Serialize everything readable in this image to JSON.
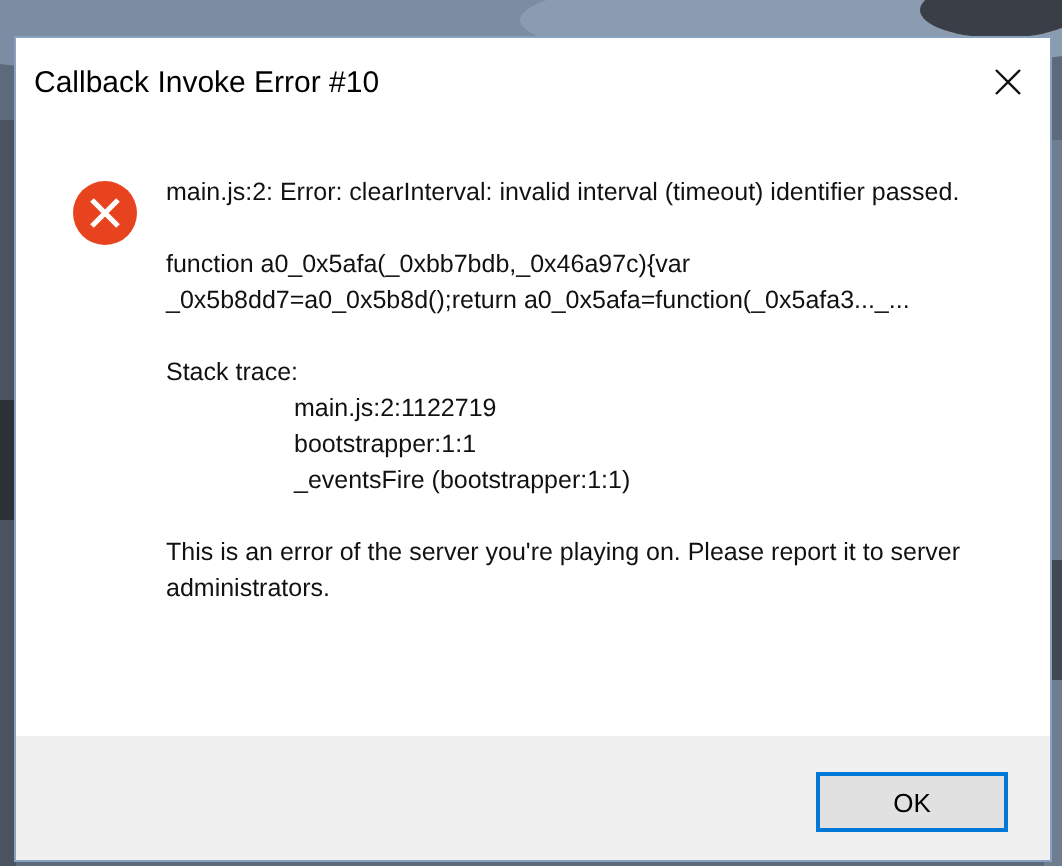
{
  "window": {
    "title": "Callback Invoke Error #10"
  },
  "message": {
    "kind": "error",
    "text": "main.js:2: Error: clearInterval: invalid interval (timeout) identifier passed.",
    "code_lines": [
      "function a0_0x5afa(_0xbb7bdb,_0x46a97c){var",
      "_0x5b8dd7=a0_0x5b8d();return a0_0x5afa=function(_0x5afa3..._..."
    ],
    "stack_label": "Stack trace:",
    "stack_frames": [
      "main.js:2:1122719",
      "bootstrapper:1:1",
      "_eventsFire (bootstrapper:1:1)"
    ],
    "note": "This is an error of the server you're playing on. Please report it to server administrators."
  },
  "buttons": [
    {
      "label": "OK",
      "focused": true
    }
  ]
}
